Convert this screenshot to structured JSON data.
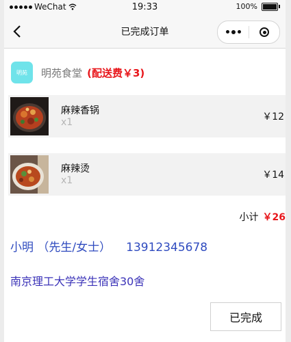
{
  "status_bar": {
    "carrier": "WeChat",
    "time": "19:33",
    "battery": "100%"
  },
  "nav": {
    "title": "已完成订单"
  },
  "shop": {
    "logo_text": "明苑",
    "name": "明苑食堂",
    "delivery_fee": "(配送费￥3)"
  },
  "items": [
    {
      "name": "麻辣香锅",
      "qty": "x1",
      "price": "￥12"
    },
    {
      "name": "麻辣烫",
      "qty": "x1",
      "price": "￥14"
    }
  ],
  "subtotal": {
    "label": "小计",
    "amount": "￥26"
  },
  "contact": {
    "name": "小明 （先生/女士）",
    "phone": "13912345678"
  },
  "address": "南京理工大学学生宿舍30舍",
  "actions": {
    "status_button": "已完成"
  },
  "colors": {
    "accent_red": "#e8161b",
    "link_blue": "#2f4bbf",
    "logo_cyan": "#6fe3ea"
  }
}
